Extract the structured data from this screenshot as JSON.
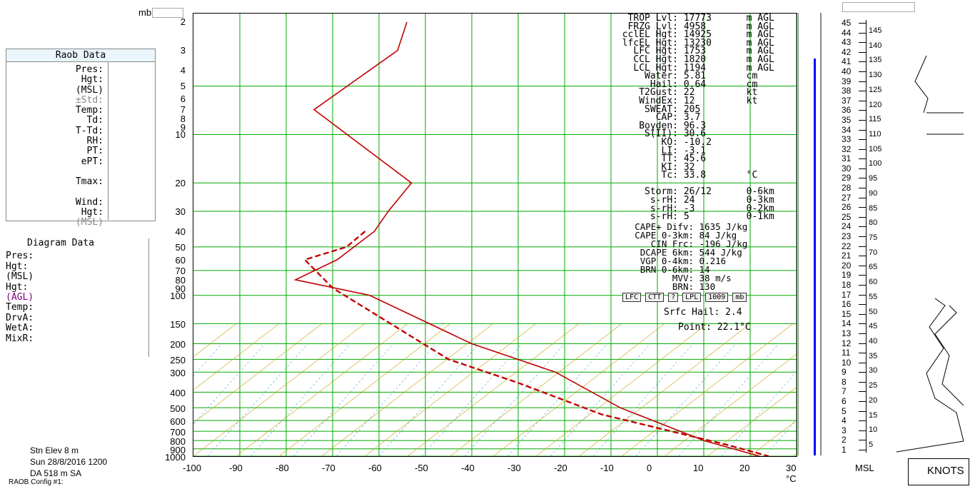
{
  "top": {
    "unit_mb": "mb",
    "mb_btn": "mb"
  },
  "raob": {
    "title": "Raob Data",
    "rows": [
      "Pres:",
      "Hgt:",
      "(MSL)",
      "±Std:",
      "Temp:",
      "Td:",
      "T-Td:",
      "RH:",
      "PT:",
      "ePT:",
      "",
      "Tmax:",
      "",
      "Wind:",
      "Hgt:",
      "(MSL)"
    ]
  },
  "diagram": {
    "title": "Diagram Data",
    "rows": [
      "Pres:",
      "Hgt:",
      "(MSL)",
      "Hgt:",
      "(AGL)",
      "Temp:",
      "",
      "DrvA:",
      "WetA:",
      "MixR:"
    ]
  },
  "pressure_labels": [
    "2",
    "3",
    "4",
    "5",
    "6",
    "7",
    "8",
    "9",
    "10",
    "20",
    "30",
    "40",
    "50",
    "60",
    "70",
    "80",
    "90",
    "100",
    "150",
    "200",
    "250",
    "300",
    "400",
    "500",
    "600",
    "700",
    "800",
    "900",
    "1000"
  ],
  "params": [
    {
      "k": "TROP Lvl:",
      "v": "17773",
      "u": "m AGL"
    },
    {
      "k": "FRZG Lvl:",
      "v": "4958",
      "u": "m AGL"
    },
    {
      "k": "cclEL Hgt:",
      "v": "14925",
      "u": "m AGL"
    },
    {
      "k": "lfcEL Hgt:",
      "v": "13230",
      "u": "m AGL"
    },
    {
      "k": "LFC Hgt:",
      "v": "1753",
      "u": "m AGL"
    },
    {
      "k": "CCL Hgt:",
      "v": "1820",
      "u": "m AGL"
    },
    {
      "k": "LCL Hgt:",
      "v": "1194",
      "u": "m AGL"
    },
    {
      "k": "Water:",
      "v": "5.81",
      "u": "cm"
    },
    {
      "k": "Hail:",
      "v": "0.64",
      "u": "cm"
    },
    {
      "k": "T2Gust:",
      "v": "22",
      "u": "kt"
    },
    {
      "k": "WindEx:",
      "v": "12",
      "u": "kt"
    },
    {
      "k": "SWEAT:",
      "v": "205",
      "u": ""
    },
    {
      "k": "CAP:",
      "v": "3.7",
      "u": ""
    },
    {
      "k": "Boyden:",
      "v": "96.3",
      "u": ""
    },
    {
      "k": "S(II):",
      "v": "30.6",
      "u": ""
    },
    {
      "k": "KO:",
      "v": "-10.2",
      "u": ""
    },
    {
      "k": "LI:",
      "v": "-3.1",
      "u": ""
    },
    {
      "k": "TT:",
      "v": "45.6",
      "u": ""
    },
    {
      "k": "KI:",
      "v": "32",
      "u": ""
    },
    {
      "k": "Tc:",
      "v": "33.8",
      "u": "°C"
    },
    {
      "k": "",
      "v": "",
      "u": ""
    },
    {
      "k": "Storm:",
      "v": "26/12",
      "u": "0-6km"
    },
    {
      "k": "s-rH:",
      "v": "24",
      "u": "0-3km"
    },
    {
      "k": "s-rH:",
      "v": "-3",
      "u": "0-2km"
    },
    {
      "k": "s-rH:",
      "v": "5",
      "u": "0-1km"
    }
  ],
  "buoy": [
    {
      "k": "CAPE+ Difv:",
      "v": "1635 J/kg"
    },
    {
      "k": "CAPE 0-3km:",
      "v": "84 J/kg"
    },
    {
      "k": "CIN Frc:",
      "v": "-196 J/kg"
    },
    {
      "k": "DCAPE 6km:",
      "v": "544 J/kg"
    },
    {
      "k": "VGP 0-4km:",
      "v": "0.216"
    },
    {
      "k": "BRN 0-6km:",
      "v": "14"
    },
    {
      "k": "MVV:",
      "v": "38 m/s"
    },
    {
      "k": "BRN:",
      "v": "130"
    }
  ],
  "buttons": [
    "LFC",
    "CTT",
    "?",
    "LPL",
    "1009",
    "mb"
  ],
  "point": {
    "k1": "Srfc Hail:",
    "v1": "2.4",
    "k2": "Point:",
    "v2": "22.1°C"
  },
  "height_km": [
    "45",
    "44",
    "43",
    "42",
    "41",
    "40",
    "39",
    "38",
    "37",
    "36",
    "35",
    "34",
    "33",
    "32",
    "31",
    "30",
    "29",
    "28",
    "27",
    "26",
    "25",
    "24",
    "23",
    "22",
    "21",
    "20",
    "19",
    "18",
    "17",
    "16",
    "15",
    "14",
    "13",
    "12",
    "11",
    "10",
    "9",
    "8",
    "7",
    "6",
    "5",
    "4",
    "3",
    "2",
    "1"
  ],
  "height_kft": [
    "145",
    "140",
    "135",
    "130",
    "125",
    "120",
    "115",
    "110",
    "105",
    "100",
    "95",
    "90",
    "85",
    "80",
    "75",
    "70",
    "65",
    "60",
    "55",
    "50",
    "45",
    "40",
    "35",
    "30",
    "25",
    "20",
    "15",
    "10",
    "5"
  ],
  "x_ticks": [
    "-100",
    "-90",
    "-80",
    "-70",
    "-60",
    "-50",
    "-40",
    "-30",
    "-20",
    "-10",
    "0",
    "10",
    "20",
    "30 °C"
  ],
  "msl_label": "MSL",
  "knots": "KNOTS",
  "station": {
    "stn_elev": "Stn Elev",
    "stn_val": "8 m",
    "line2": "Sun 28/8/2016 1200",
    "da": "DA",
    "da_val": "518",
    "da_u": "m",
    "sa": "SA",
    "config": "RAOB Config #1:"
  },
  "colors": {
    "temp": "#c00000",
    "dew": "#c00000",
    "isotherm": "#00aa00",
    "dryadiabat": "#c8a000",
    "wetadiabat": "#4aa8d8",
    "mixing": "#30b030",
    "blue": "#0000ff"
  },
  "chart_data": {
    "type": "line",
    "xlabel": "°C",
    "ylabel": "mb",
    "xlim": [
      -100,
      30
    ],
    "series": [
      {
        "values_temp_x": [
          -54,
          -56,
          -74,
          -53,
          -58,
          -61,
          -69,
          -78,
          -62,
          -40,
          -22,
          -8,
          10,
          22
        ],
        "pressure": [
          2,
          3,
          7,
          20,
          30,
          40,
          60,
          80,
          100,
          200,
          300,
          500,
          800,
          1000
        ]
      },
      {
        "values_dew_x": [
          -63,
          -67,
          -76,
          -70,
          -45,
          -30,
          -12,
          15,
          24
        ],
        "pressure": [
          40,
          50,
          60,
          90,
          250,
          350,
          550,
          850,
          1000
        ]
      }
    ]
  }
}
